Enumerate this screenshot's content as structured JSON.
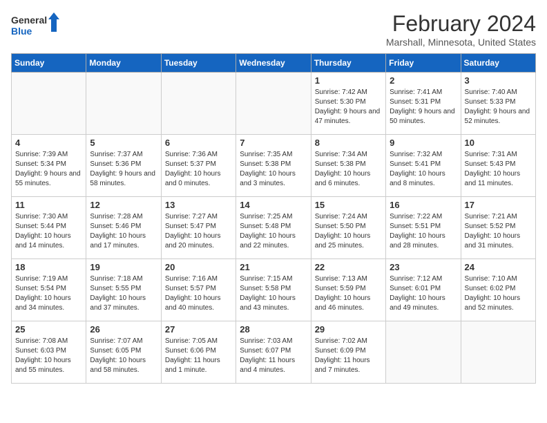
{
  "header": {
    "logo_line1": "General",
    "logo_line2": "Blue",
    "month": "February 2024",
    "location": "Marshall, Minnesota, United States"
  },
  "days_of_week": [
    "Sunday",
    "Monday",
    "Tuesday",
    "Wednesday",
    "Thursday",
    "Friday",
    "Saturday"
  ],
  "weeks": [
    [
      {
        "day": "",
        "info": ""
      },
      {
        "day": "",
        "info": ""
      },
      {
        "day": "",
        "info": ""
      },
      {
        "day": "",
        "info": ""
      },
      {
        "day": "1",
        "info": "Sunrise: 7:42 AM\nSunset: 5:30 PM\nDaylight: 9 hours and 47 minutes."
      },
      {
        "day": "2",
        "info": "Sunrise: 7:41 AM\nSunset: 5:31 PM\nDaylight: 9 hours and 50 minutes."
      },
      {
        "day": "3",
        "info": "Sunrise: 7:40 AM\nSunset: 5:33 PM\nDaylight: 9 hours and 52 minutes."
      }
    ],
    [
      {
        "day": "4",
        "info": "Sunrise: 7:39 AM\nSunset: 5:34 PM\nDaylight: 9 hours and 55 minutes."
      },
      {
        "day": "5",
        "info": "Sunrise: 7:37 AM\nSunset: 5:36 PM\nDaylight: 9 hours and 58 minutes."
      },
      {
        "day": "6",
        "info": "Sunrise: 7:36 AM\nSunset: 5:37 PM\nDaylight: 10 hours and 0 minutes."
      },
      {
        "day": "7",
        "info": "Sunrise: 7:35 AM\nSunset: 5:38 PM\nDaylight: 10 hours and 3 minutes."
      },
      {
        "day": "8",
        "info": "Sunrise: 7:34 AM\nSunset: 5:38 PM\nDaylight: 10 hours and 6 minutes."
      },
      {
        "day": "9",
        "info": "Sunrise: 7:32 AM\nSunset: 5:41 PM\nDaylight: 10 hours and 8 minutes."
      },
      {
        "day": "10",
        "info": "Sunrise: 7:31 AM\nSunset: 5:43 PM\nDaylight: 10 hours and 11 minutes."
      }
    ],
    [
      {
        "day": "11",
        "info": "Sunrise: 7:30 AM\nSunset: 5:44 PM\nDaylight: 10 hours and 14 minutes."
      },
      {
        "day": "12",
        "info": "Sunrise: 7:28 AM\nSunset: 5:46 PM\nDaylight: 10 hours and 17 minutes."
      },
      {
        "day": "13",
        "info": "Sunrise: 7:27 AM\nSunset: 5:47 PM\nDaylight: 10 hours and 20 minutes."
      },
      {
        "day": "14",
        "info": "Sunrise: 7:25 AM\nSunset: 5:48 PM\nDaylight: 10 hours and 22 minutes."
      },
      {
        "day": "15",
        "info": "Sunrise: 7:24 AM\nSunset: 5:50 PM\nDaylight: 10 hours and 25 minutes."
      },
      {
        "day": "16",
        "info": "Sunrise: 7:22 AM\nSunset: 5:51 PM\nDaylight: 10 hours and 28 minutes."
      },
      {
        "day": "17",
        "info": "Sunrise: 7:21 AM\nSunset: 5:52 PM\nDaylight: 10 hours and 31 minutes."
      }
    ],
    [
      {
        "day": "18",
        "info": "Sunrise: 7:19 AM\nSunset: 5:54 PM\nDaylight: 10 hours and 34 minutes."
      },
      {
        "day": "19",
        "info": "Sunrise: 7:18 AM\nSunset: 5:55 PM\nDaylight: 10 hours and 37 minutes."
      },
      {
        "day": "20",
        "info": "Sunrise: 7:16 AM\nSunset: 5:57 PM\nDaylight: 10 hours and 40 minutes."
      },
      {
        "day": "21",
        "info": "Sunrise: 7:15 AM\nSunset: 5:58 PM\nDaylight: 10 hours and 43 minutes."
      },
      {
        "day": "22",
        "info": "Sunrise: 7:13 AM\nSunset: 5:59 PM\nDaylight: 10 hours and 46 minutes."
      },
      {
        "day": "23",
        "info": "Sunrise: 7:12 AM\nSunset: 6:01 PM\nDaylight: 10 hours and 49 minutes."
      },
      {
        "day": "24",
        "info": "Sunrise: 7:10 AM\nSunset: 6:02 PM\nDaylight: 10 hours and 52 minutes."
      }
    ],
    [
      {
        "day": "25",
        "info": "Sunrise: 7:08 AM\nSunset: 6:03 PM\nDaylight: 10 hours and 55 minutes."
      },
      {
        "day": "26",
        "info": "Sunrise: 7:07 AM\nSunset: 6:05 PM\nDaylight: 10 hours and 58 minutes."
      },
      {
        "day": "27",
        "info": "Sunrise: 7:05 AM\nSunset: 6:06 PM\nDaylight: 11 hours and 1 minute."
      },
      {
        "day": "28",
        "info": "Sunrise: 7:03 AM\nSunset: 6:07 PM\nDaylight: 11 hours and 4 minutes."
      },
      {
        "day": "29",
        "info": "Sunrise: 7:02 AM\nSunset: 6:09 PM\nDaylight: 11 hours and 7 minutes."
      },
      {
        "day": "",
        "info": ""
      },
      {
        "day": "",
        "info": ""
      }
    ]
  ]
}
